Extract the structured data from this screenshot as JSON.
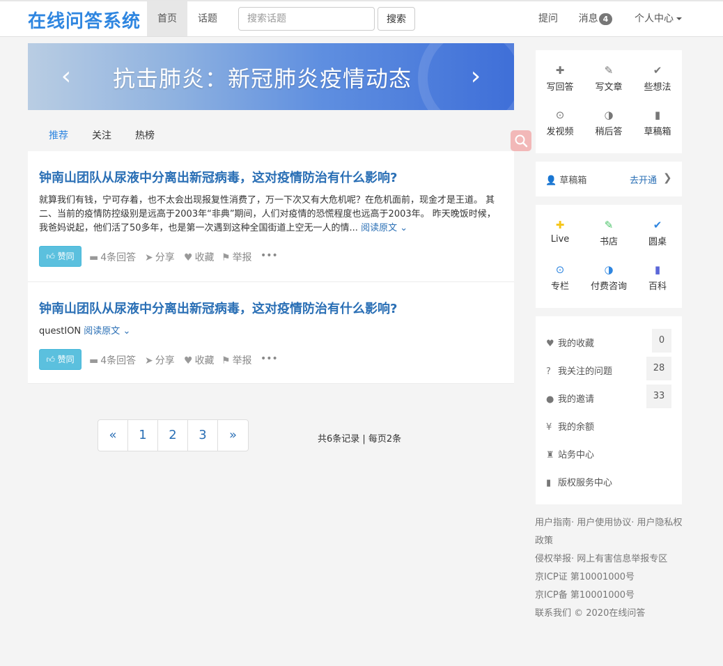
{
  "nav": {
    "brand": "在线问答系统",
    "home": "首页",
    "topics": "话题",
    "search_placeholder": "搜索话题",
    "search_button": "搜索",
    "ask": "提问",
    "messages": "消息",
    "message_count": "4",
    "profile": "个人中心"
  },
  "banner": {
    "text": "抗击肺炎：新冠肺炎疫情动态",
    "prev": "‹",
    "next": "›"
  },
  "feed_tabs": [
    {
      "label": "推荐",
      "active": true
    },
    {
      "label": "关注",
      "active": false
    },
    {
      "label": "热榜",
      "active": false
    }
  ],
  "posts": [
    {
      "title": "钟南山团队从尿液中分离出新冠病毒，这对疫情防治有什么影响?",
      "body": "就算我们有钱，宁可存着，也不太会出现报复性消费了，万一下次又有大危机呢？在危机面前，现金才是王道。 其二、当前的疫情防控级别是远高于2003年“非典”期间，人们对疫情的恐慌程度也远高于2003年。 昨天晚饭时候，我爸妈说起，他们活了50多年，也是第一次遇到这种全国街道上空无一人的情...",
      "read_more": "阅读原文",
      "vote": "赞同",
      "answers": "4条回答",
      "share": "分享",
      "favorite": "收藏",
      "report": "举报",
      "more": "•••"
    },
    {
      "title": "钟南山团队从尿液中分离出新冠病毒，这对疫情防治有什么影响?",
      "body": "questION",
      "read_more": "阅读原文",
      "vote": "赞同",
      "answers": "4条回答",
      "share": "分享",
      "favorite": "收藏",
      "report": "举报",
      "more": "•••"
    }
  ],
  "pagination": {
    "prev": "«",
    "pages": [
      "1",
      "2",
      "3"
    ],
    "next": "»",
    "summary": "共6条记录 | 每页2条"
  },
  "sidebar": {
    "tools": [
      {
        "label": "写回答",
        "icon": "plus-icon",
        "glyph": "✚"
      },
      {
        "label": "写文章",
        "icon": "pencil-icon",
        "glyph": "✎"
      },
      {
        "label": "些想法",
        "icon": "check-icon",
        "glyph": "✔"
      },
      {
        "label": "发视频",
        "icon": "play-circle-icon",
        "glyph": "⊙"
      },
      {
        "label": "稍后答",
        "icon": "half-circle-icon",
        "glyph": "◑"
      },
      {
        "label": "草稿箱",
        "icon": "file-icon",
        "glyph": "▮"
      }
    ],
    "drafts": {
      "label": "草稿箱",
      "open": "去开通"
    },
    "services": [
      {
        "label": "Live",
        "icon": "plus-icon",
        "glyph": "✚",
        "color": "#f5c518"
      },
      {
        "label": "书店",
        "icon": "pencil-icon",
        "glyph": "✎",
        "color": "#4cc36a"
      },
      {
        "label": "圆桌",
        "icon": "check-icon",
        "glyph": "✔",
        "color": "#2f86e0"
      },
      {
        "label": "专栏",
        "icon": "play-circle-icon",
        "glyph": "⊙",
        "color": "#2f86e0"
      },
      {
        "label": "付费咨询",
        "icon": "half-circle-icon",
        "glyph": "◑",
        "color": "#2f86e0"
      },
      {
        "label": "百科",
        "icon": "file-icon",
        "glyph": "▮",
        "color": "#5b67d8"
      }
    ],
    "menu": [
      {
        "label": "我的收藏",
        "icon": "heart-icon",
        "glyph": "♥",
        "count": "0"
      },
      {
        "label": "我关注的问题",
        "icon": "question-circle-icon",
        "glyph": "❓",
        "count": "28"
      },
      {
        "label": "我的邀请",
        "icon": "user-icon",
        "glyph": "👤",
        "count": "33"
      },
      {
        "label": "我的余额",
        "icon": "yen-icon",
        "glyph": "¥",
        "count": ""
      },
      {
        "label": "站务中心",
        "icon": "stamp-icon",
        "glyph": "♜",
        "count": ""
      },
      {
        "label": "版权服务中心",
        "icon": "file-icon",
        "glyph": "▮",
        "count": ""
      }
    ]
  },
  "footer": {
    "line1": "用户指南· 用户使用协议· 用户隐私权政策",
    "line2": "侵权举报· 网上有害信息举报专区",
    "line3": "京ICP证 第10001000号",
    "line4": "京ICP备 第10001000号",
    "line5": "联系我们 © 2020在线问答"
  }
}
